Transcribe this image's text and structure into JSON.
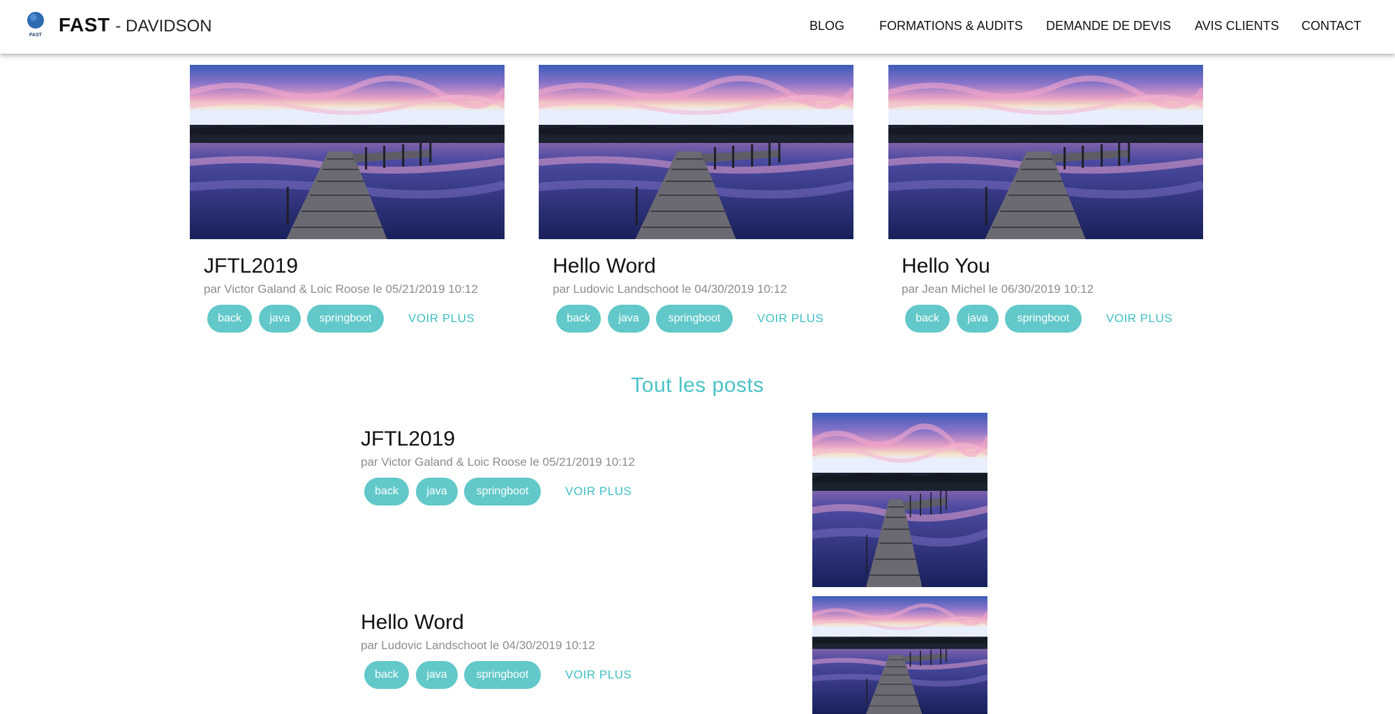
{
  "header": {
    "brand_main": "FAST",
    "brand_sub": "- DAVIDSON",
    "logo_text": "FAST",
    "nav": [
      "BLOG",
      "FORMATIONS & AUDITS",
      "DEMANDE DE DEVIS",
      "AVIS CLIENTS",
      "CONTACT"
    ]
  },
  "featured": [
    {
      "title": "JFTL2019",
      "meta": "par Victor Galand & Loic Roose le 05/21/2019 10:12",
      "tags": [
        "back",
        "java",
        "springboot"
      ],
      "more_label": "VOIR PLUS"
    },
    {
      "title": "Hello Word",
      "meta": "par Ludovic Landschoot le 04/30/2019 10:12",
      "tags": [
        "back",
        "java",
        "springboot"
      ],
      "more_label": "VOIR PLUS"
    },
    {
      "title": "Hello You",
      "meta": "par Jean Michel le 06/30/2019 10:12",
      "tags": [
        "back",
        "java",
        "springboot"
      ],
      "more_label": "VOIR PLUS"
    }
  ],
  "all_posts": {
    "section_title": "Tout les posts",
    "posts": [
      {
        "title": "JFTL2019",
        "meta": "par Victor Galand & Loic Roose le 05/21/2019 10:12",
        "tags": [
          "back",
          "java",
          "springboot"
        ],
        "more_label": "VOIR PLUS"
      },
      {
        "title": "Hello Word",
        "meta": "par Ludovic Landschoot le 04/30/2019 10:12",
        "tags": [
          "back",
          "java",
          "springboot"
        ],
        "more_label": "VOIR PLUS"
      }
    ]
  },
  "colors": {
    "accent": "#62c8c9",
    "accent_text": "#3fbfc4",
    "meta_text": "#8c8c8c"
  }
}
